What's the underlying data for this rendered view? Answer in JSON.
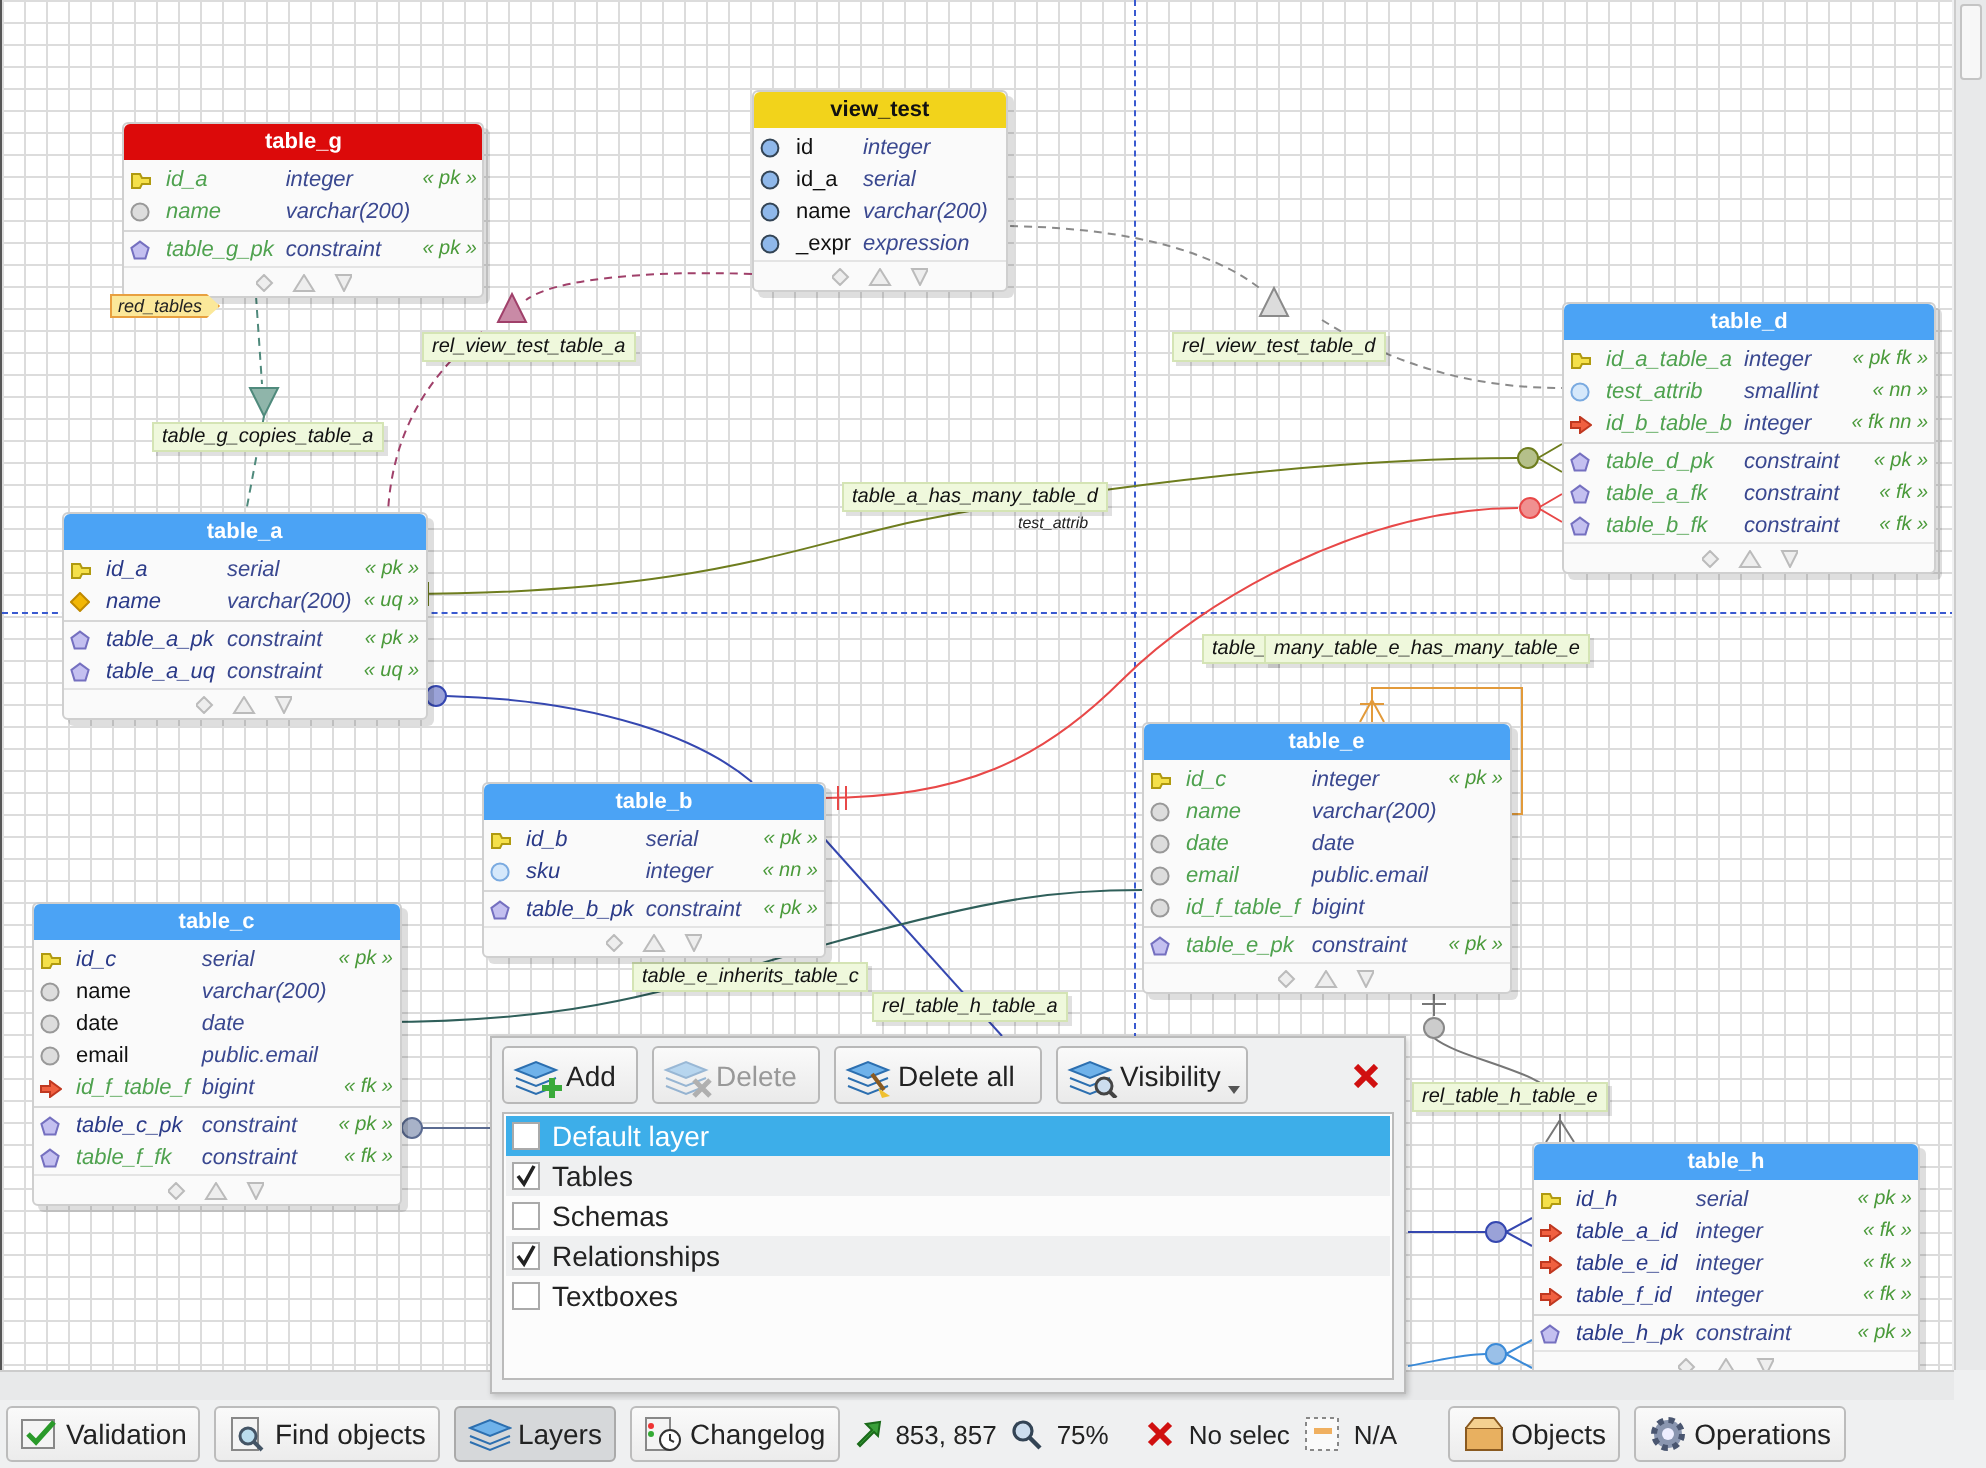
{
  "tables": [
    {
      "name": "view_test",
      "color": "#f2d31b",
      "columns": [
        {
          "kind": "view",
          "added": false,
          "name": "id",
          "type": "integer"
        },
        {
          "kind": "view",
          "added": false,
          "name": "id_a",
          "type": "serial"
        },
        {
          "kind": "view",
          "added": false,
          "name": "name",
          "type": "varchar(200)"
        },
        {
          "kind": "view",
          "added": false,
          "name": "_expr",
          "type": "expression"
        }
      ]
    },
    {
      "name": "table_g",
      "color": "#dc0a0a",
      "tag": "red_tables",
      "columns": [
        {
          "kind": "pk",
          "added": true,
          "name": "id_a",
          "type": "integer",
          "constraint": "« pk »"
        },
        {
          "kind": "plain",
          "added": true,
          "name": "name",
          "type": "varchar(200)"
        }
      ],
      "constraints": [
        {
          "added": true,
          "name": "table_g_pk",
          "type": "constraint",
          "constraint": "« pk »"
        }
      ]
    },
    {
      "name": "table_d",
      "color": "#4ba3f5",
      "columns": [
        {
          "kind": "pk",
          "added": true,
          "name": "id_a_table_a",
          "type": "integer",
          "constraint": "« pk fk »"
        },
        {
          "kind": "nn",
          "added": true,
          "name": "test_attrib",
          "type": "smallint",
          "constraint": "« nn »"
        },
        {
          "kind": "fk",
          "added": true,
          "name": "id_b_table_b",
          "type": "integer",
          "constraint": "« fk nn »"
        }
      ],
      "constraints": [
        {
          "added": true,
          "name": "table_d_pk",
          "type": "constraint",
          "constraint": "« pk »"
        },
        {
          "added": true,
          "name": "table_a_fk",
          "type": "constraint",
          "constraint": "« fk »"
        },
        {
          "added": true,
          "name": "table_b_fk",
          "type": "constraint",
          "constraint": "« fk »"
        }
      ]
    },
    {
      "name": "table_a",
      "color": "#4ba3f5",
      "columns": [
        {
          "kind": "pk",
          "added": false,
          "name": "id_a",
          "type": "serial",
          "constraint": "« pk »"
        },
        {
          "kind": "uq",
          "added": false,
          "name": "name",
          "type": "varchar(200)",
          "constraint": "« uq »"
        }
      ],
      "constraints": [
        {
          "added": false,
          "name": "table_a_pk",
          "type": "constraint",
          "constraint": "« pk »"
        },
        {
          "added": false,
          "name": "table_a_uq",
          "type": "constraint",
          "constraint": "« uq »"
        }
      ]
    },
    {
      "name": "table_e",
      "color": "#4ba3f5",
      "columns": [
        {
          "kind": "pk",
          "added": true,
          "name": "id_c",
          "type": "integer",
          "constraint": "« pk »"
        },
        {
          "kind": "plain",
          "added": true,
          "name": "name",
          "type": "varchar(200)"
        },
        {
          "kind": "plain",
          "added": true,
          "name": "date",
          "type": "date"
        },
        {
          "kind": "plain",
          "added": true,
          "name": "email",
          "type": "public.email"
        },
        {
          "kind": "plain",
          "added": true,
          "name": "id_f_table_f",
          "type": "bigint"
        }
      ],
      "constraints": [
        {
          "added": true,
          "name": "table_e_pk",
          "type": "constraint",
          "constraint": "« pk »"
        }
      ]
    },
    {
      "name": "table_b",
      "color": "#4ba3f5",
      "columns": [
        {
          "kind": "pk",
          "added": false,
          "name": "id_b",
          "type": "serial",
          "constraint": "« pk »"
        },
        {
          "kind": "nn",
          "added": false,
          "name": "sku",
          "type": "integer",
          "constraint": "« nn »"
        }
      ],
      "constraints": [
        {
          "added": false,
          "name": "table_b_pk",
          "type": "constraint",
          "constraint": "« pk »"
        }
      ]
    },
    {
      "name": "table_c",
      "color": "#4ba3f5",
      "columns": [
        {
          "kind": "pk",
          "added": false,
          "name": "id_c",
          "type": "serial",
          "constraint": "« pk »"
        },
        {
          "kind": "plain",
          "added": false,
          "name": "name",
          "type": "varchar(200)"
        },
        {
          "kind": "plain",
          "added": false,
          "name": "date",
          "type": "date"
        },
        {
          "kind": "plain",
          "added": false,
          "name": "email",
          "type": "public.email"
        },
        {
          "kind": "fk",
          "added": true,
          "name": "id_f_table_f",
          "type": "bigint",
          "constraint": "« fk »"
        }
      ],
      "constraints": [
        {
          "added": false,
          "name": "table_c_pk",
          "type": "constraint",
          "constraint": "« pk »"
        },
        {
          "added": true,
          "name": "table_f_fk",
          "type": "constraint",
          "constraint": "« fk »"
        }
      ]
    },
    {
      "name": "table_h",
      "color": "#4ba3f5",
      "columns": [
        {
          "kind": "pk",
          "added": false,
          "name": "id_h",
          "type": "serial",
          "constraint": "« pk »"
        },
        {
          "kind": "fk",
          "added": false,
          "name": "table_a_id",
          "type": "integer",
          "constraint": "« fk »"
        },
        {
          "kind": "fk",
          "added": false,
          "name": "table_e_id",
          "type": "integer",
          "constraint": "« fk »"
        },
        {
          "kind": "fk",
          "added": false,
          "name": "table_f_id",
          "type": "integer",
          "constraint": "« fk »"
        }
      ],
      "constraints": [
        {
          "added": false,
          "name": "table_h_pk",
          "type": "constraint",
          "constraint": "« pk »"
        }
      ]
    }
  ],
  "relationships": [
    {
      "name": "rel_view_test_table_a"
    },
    {
      "name": "rel_view_test_table_d"
    },
    {
      "name": "table_g_copies_table_a"
    },
    {
      "name": "table_a_has_many_table_d",
      "attribute": "test_attrib"
    },
    {
      "name": "table_"
    },
    {
      "name": "many_table_e_has_many_table_e"
    },
    {
      "name": "table_e_inherits_table_c"
    },
    {
      "name": "rel_table_h_table_a"
    },
    {
      "name": "rel_table_h_table_e"
    }
  ],
  "layers_panel": {
    "buttons": [
      {
        "kind": "add",
        "label": "Add",
        "disabled": false
      },
      {
        "kind": "delete",
        "label": "Delete",
        "disabled": true
      },
      {
        "kind": "delete_all",
        "label": "Delete all",
        "disabled": false
      },
      {
        "kind": "visibility",
        "label": "Visibility",
        "disabled": false
      }
    ],
    "layers": [
      {
        "name": "Default layer",
        "checked": false,
        "selected": true
      },
      {
        "name": "Tables",
        "checked": true,
        "selected": false
      },
      {
        "name": "Schemas",
        "checked": false,
        "selected": false
      },
      {
        "name": "Relationships",
        "checked": true,
        "selected": false
      },
      {
        "name": "Textboxes",
        "checked": false,
        "selected": false
      }
    ]
  },
  "status_bar": {
    "left_buttons": [
      {
        "kind": "validation",
        "label": "Validation",
        "pressed": false
      },
      {
        "kind": "find",
        "label": "Find objects",
        "pressed": false
      },
      {
        "kind": "layers",
        "label": "Layers",
        "pressed": true
      },
      {
        "kind": "changelog",
        "label": "Changelog",
        "pressed": false
      }
    ],
    "cursor_position": "853, 857",
    "zoom": "75%",
    "selection": "No selec",
    "object_info": "N/A",
    "right_buttons": [
      {
        "kind": "objects",
        "label": "Objects",
        "pressed": false
      },
      {
        "kind": "operations",
        "label": "Operations",
        "pressed": false
      }
    ]
  }
}
